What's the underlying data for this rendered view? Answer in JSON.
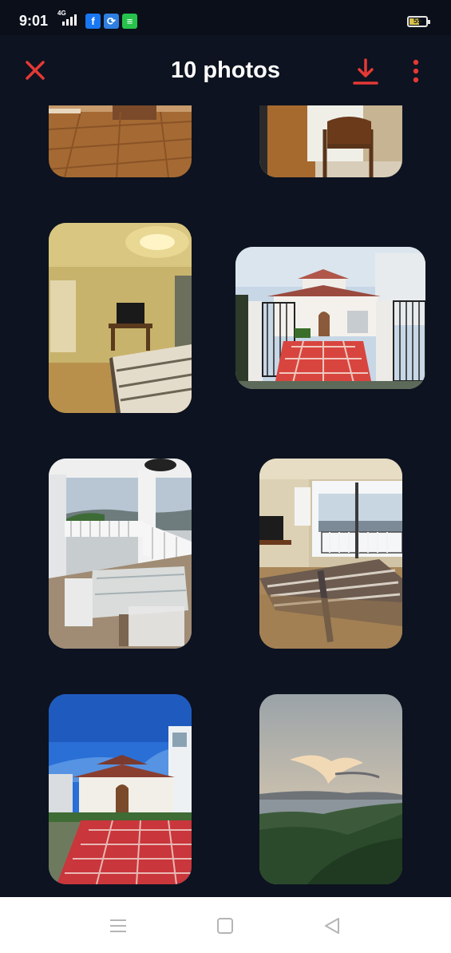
{
  "status_bar": {
    "time": "9:01",
    "network": "4G",
    "battery_level": "55",
    "notification_icons": [
      "facebook-icon",
      "sync-icon",
      "messages-icon"
    ]
  },
  "header": {
    "title": "10 photos",
    "icons": [
      "close-icon",
      "download-icon",
      "more-vertical-icon"
    ],
    "accent_color": "#e53935"
  },
  "photos": [
    {
      "subject": "tiled floor room"
    },
    {
      "subject": "room with rocking chair"
    },
    {
      "subject": "bedroom with lamp"
    },
    {
      "subject": "house entrance with gate"
    },
    {
      "subject": "balcony with dining table"
    },
    {
      "subject": "bedroom with lake view"
    },
    {
      "subject": "house front under blue sky"
    },
    {
      "subject": "lake and hills at dusk"
    }
  ],
  "nav_bar": {
    "icons": [
      "menu-icon",
      "home-icon",
      "back-icon"
    ]
  }
}
